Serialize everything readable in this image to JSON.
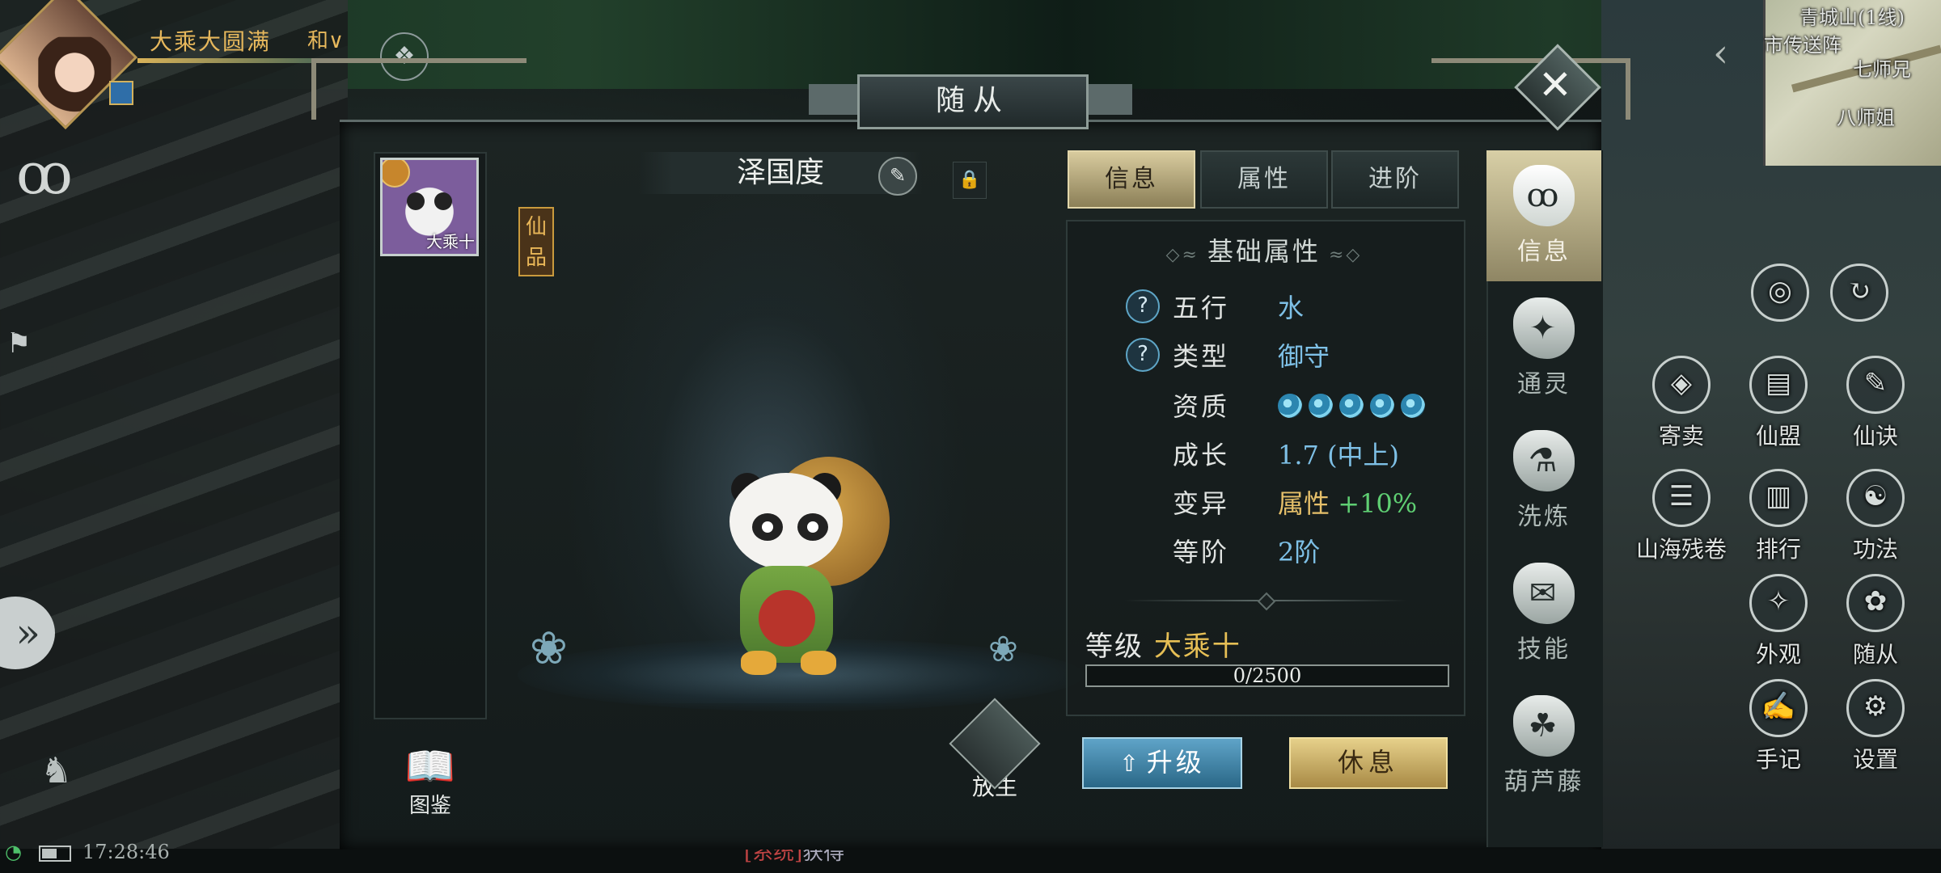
{
  "player": {
    "realm_name": "大乘大圆满",
    "channel": "和"
  },
  "minimap": {
    "location": "青城山(1线)",
    "labels": [
      "市传送阵",
      "七师兄",
      "八师姐"
    ]
  },
  "dialog": {
    "title": "随从",
    "close_icon": "close-icon"
  },
  "pet": {
    "name": "泽国度",
    "thumb_level": "大乘十",
    "grade_tag": [
      "仙",
      "品"
    ]
  },
  "tabs": [
    {
      "label": "信息",
      "active": true
    },
    {
      "label": "属性",
      "active": false
    },
    {
      "label": "进阶",
      "active": false
    }
  ],
  "basic_attributes": {
    "title": "基础属性",
    "rows": {
      "wuxing": {
        "label": "五行",
        "value": "水",
        "help": "?"
      },
      "type": {
        "label": "类型",
        "value": "御守",
        "help": "?"
      },
      "aptitude": {
        "label": "资质",
        "value": 5
      },
      "growth": {
        "label": "成长",
        "value": "1.7 (中上)"
      },
      "mutation": {
        "label": "变异",
        "value": "属性",
        "bonus": "+10%"
      },
      "tier": {
        "label": "等阶",
        "value": "2阶"
      }
    }
  },
  "level": {
    "label": "等级",
    "value": "大乘十",
    "xp_text": "0/2500",
    "xp_fraction": 0
  },
  "actions": {
    "upgrade": "升级",
    "rest": "休息",
    "release": "放生",
    "atlas": "图鉴"
  },
  "side_nav": [
    {
      "label": "信息",
      "icon": "gourd-info-icon",
      "active": true
    },
    {
      "label": "通灵",
      "icon": "spirit-icon",
      "active": false
    },
    {
      "label": "洗炼",
      "icon": "refine-icon",
      "active": false
    },
    {
      "label": "技能",
      "icon": "skill-scroll-icon",
      "active": false
    },
    {
      "label": "葫芦藤",
      "icon": "gourd-vine-icon",
      "active": false
    }
  ],
  "right_menu": [
    {
      "label": "寄卖",
      "icon": "consign-icon"
    },
    {
      "label": "仙盟",
      "icon": "guild-icon"
    },
    {
      "label": "仙诀",
      "icon": "art-icon"
    },
    {
      "label": "山海残卷",
      "icon": "scroll-icon"
    },
    {
      "label": "排行",
      "icon": "rank-icon"
    },
    {
      "label": "功法",
      "icon": "taiji-icon"
    },
    {
      "label": "外观",
      "icon": "appearance-icon"
    },
    {
      "label": "随从",
      "icon": "companion-icon"
    },
    {
      "label": "手记",
      "icon": "notebook-icon"
    },
    {
      "label": "设置",
      "icon": "gear-icon"
    }
  ],
  "status": {
    "time": "17:28:46"
  },
  "chat_peek": {
    "channel": "[系统]",
    "text": "获得"
  }
}
